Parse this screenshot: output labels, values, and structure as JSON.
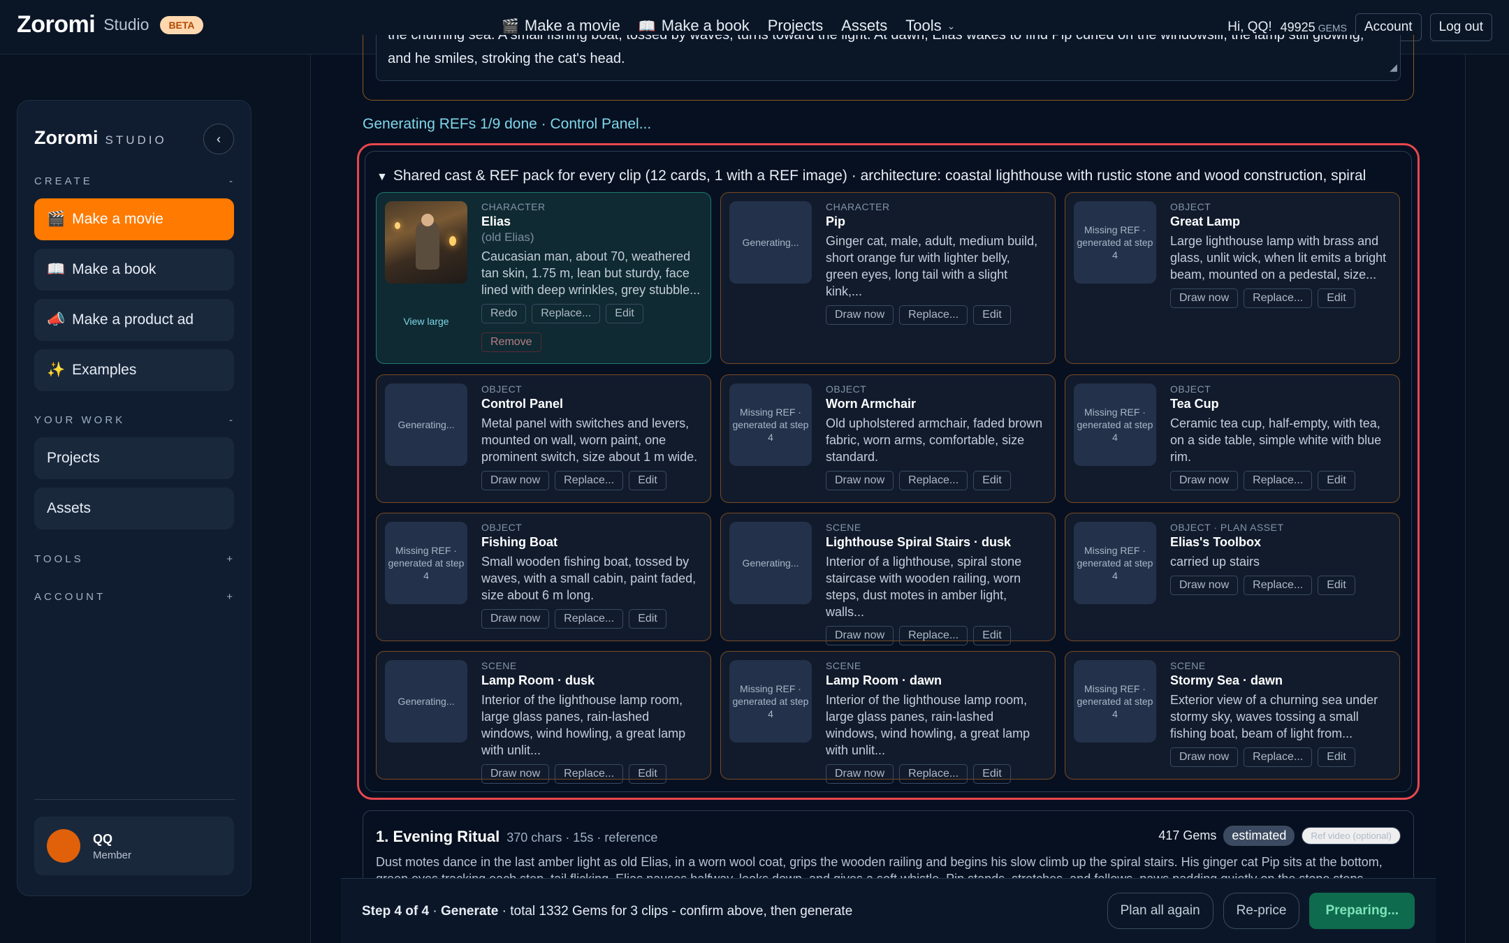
{
  "topnav": {
    "brand": "Zoromi",
    "brand_sub": "Studio",
    "beta": "BETA",
    "items": [
      {
        "icon": "🎬",
        "label": "Make a movie"
      },
      {
        "icon": "📖",
        "label": "Make a book"
      },
      {
        "label": "Projects"
      },
      {
        "label": "Assets"
      },
      {
        "label": "Tools",
        "chevron": "⌄"
      }
    ],
    "greeting": "Hi, QQ!",
    "gems_value": "49925",
    "gems_unit": "GEMS",
    "account": "Account",
    "logout": "Log out"
  },
  "sidebar": {
    "brand": "Zoromi",
    "studio": "STUDIO",
    "collapse_glyph": "‹",
    "create_label": "CREATE",
    "create_toggle": "-",
    "create_items": [
      {
        "icon": "🎬",
        "label": "Make a movie"
      },
      {
        "icon": "📖",
        "label": "Make a book"
      },
      {
        "icon": "📣",
        "label": "Make a product ad"
      },
      {
        "icon": "✨",
        "label": "Examples"
      }
    ],
    "work_label": "YOUR WORK",
    "work_toggle": "-",
    "work_items": [
      "Projects",
      "Assets"
    ],
    "tools_label": "TOOLS",
    "tools_toggle": "+",
    "account_label": "ACCOUNT",
    "account_toggle": "+",
    "user_name": "QQ",
    "user_role": "Member"
  },
  "main": {
    "prompt_text": "the churning sea. A small fishing boat, tossed by waves, turns toward the light. At dawn, Elias wakes to find Pip curled on the windowsill, the lamp still glowing, and he smiles, stroking the cat's head.",
    "status": "Generating REFs 1/9 done · Control Panel...",
    "refpack_title": "Shared cast & REF pack for every clip (12 cards, 1 with a REF image) · architecture: coastal lighthouse with rustic stone and wood construction, spiral",
    "refpack_toggle": "▼",
    "cards": [
      {
        "kind": "CHARACTER",
        "name": "Elias",
        "alias": "(old Elias)",
        "desc": "Caucasian man, about 70, weathered tan skin, 1.75 m, lean but sturdy, face lined with deep wrinkles, grey stubble...",
        "thumb": "",
        "view_large": "View large",
        "buttons": [
          "Redo",
          "Replace...",
          "Edit"
        ],
        "remove": "Remove"
      },
      {
        "kind": "CHARACTER",
        "name": "Pip",
        "desc": "Ginger cat, male, adult, medium build, short orange fur with lighter belly, green eyes, long tail with a slight kink,...",
        "thumb": "Generating...",
        "buttons": [
          "Draw now",
          "Replace...",
          "Edit"
        ]
      },
      {
        "kind": "OBJECT",
        "name": "Great Lamp",
        "desc": "Large lighthouse lamp with brass and glass, unlit wick, when lit emits a bright beam, mounted on a pedestal, size...",
        "thumb": "Missing REF · generated at step 4",
        "buttons": [
          "Draw now",
          "Replace...",
          "Edit"
        ]
      },
      {
        "kind": "OBJECT",
        "name": "Control Panel",
        "desc": "Metal panel with switches and levers, mounted on wall, worn paint, one prominent switch, size about 1 m wide.",
        "thumb": "Generating...",
        "buttons": [
          "Draw now",
          "Replace...",
          "Edit"
        ]
      },
      {
        "kind": "OBJECT",
        "name": "Worn Armchair",
        "desc": "Old upholstered armchair, faded brown fabric, worn arms, comfortable, size standard.",
        "thumb": "Missing REF · generated at step 4",
        "buttons": [
          "Draw now",
          "Replace...",
          "Edit"
        ]
      },
      {
        "kind": "OBJECT",
        "name": "Tea Cup",
        "desc": "Ceramic tea cup, half-empty, with tea, on a side table, simple white with blue rim.",
        "thumb": "Missing REF · generated at step 4",
        "buttons": [
          "Draw now",
          "Replace...",
          "Edit"
        ]
      },
      {
        "kind": "OBJECT",
        "name": "Fishing Boat",
        "desc": "Small wooden fishing boat, tossed by waves, with a small cabin, paint faded, size about 6 m long.",
        "thumb": "Missing REF · generated at step 4",
        "buttons": [
          "Draw now",
          "Replace...",
          "Edit"
        ]
      },
      {
        "kind": "SCENE",
        "name": "Lighthouse Spiral Stairs · dusk",
        "desc": "Interior of a lighthouse, spiral stone staircase with wooden railing, worn steps, dust motes in amber light, walls...",
        "thumb": "Generating...",
        "buttons": [
          "Draw now",
          "Replace...",
          "Edit"
        ]
      },
      {
        "kind": "OBJECT · PLAN ASSET",
        "name": "Elias's Toolbox",
        "desc": "carried up stairs",
        "thumb": "Missing REF · generated at step 4",
        "buttons": [
          "Draw now",
          "Replace...",
          "Edit"
        ]
      },
      {
        "kind": "SCENE",
        "name": "Lamp Room · dusk",
        "desc": "Interior of the lighthouse lamp room, large glass panes, rain-lashed windows, wind howling, a great lamp with unlit...",
        "thumb": "Generating...",
        "buttons": [
          "Draw now",
          "Replace...",
          "Edit"
        ]
      },
      {
        "kind": "SCENE",
        "name": "Lamp Room · dawn",
        "desc": "Interior of the lighthouse lamp room, large glass panes, rain-lashed windows, wind howling, a great lamp with unlit...",
        "thumb": "Missing REF · generated at step 4",
        "buttons": [
          "Draw now",
          "Replace...",
          "Edit"
        ]
      },
      {
        "kind": "SCENE",
        "name": "Stormy Sea · dawn",
        "desc": "Exterior view of a churning sea under stormy sky, waves tossing a small fishing boat, beam of light from...",
        "thumb": "Missing REF · generated at step 4",
        "buttons": [
          "Draw now",
          "Replace...",
          "Edit"
        ]
      }
    ],
    "clip": {
      "title": "1. Evening Ritual",
      "meta": "370 chars · 15s · reference",
      "gems": "417 Gems",
      "estimated": "estimated",
      "ref_video": "Ref video (optional)",
      "text": "Dust motes dance in the last amber light as old Elias, in a worn wool coat, grips the wooden railing and begins his slow climb up the spiral stairs. His ginger cat Pip sits at the bottom, green eyes tracking each step, tail flicking. Elias pauses halfway, looks down, and gives a soft whistle. Pip stands, stretches, and follows, paws padding quietly on the stone steps."
    }
  },
  "bottombar": {
    "step": "Step 4 of 4",
    "stage": "Generate",
    "summary": "· total 1332 Gems for 3 clips - confirm above, then generate",
    "plan_again": "Plan all again",
    "reprice": "Re-price",
    "preparing": "Preparing..."
  },
  "colors": {
    "accent": "#ff7a00",
    "highlight_border": "#e8474f",
    "status_text": "#7fd7ea",
    "card_border": "#7a4a22",
    "filled_card_border": "#1d7a72",
    "primary_button": "#0f6b4e"
  }
}
